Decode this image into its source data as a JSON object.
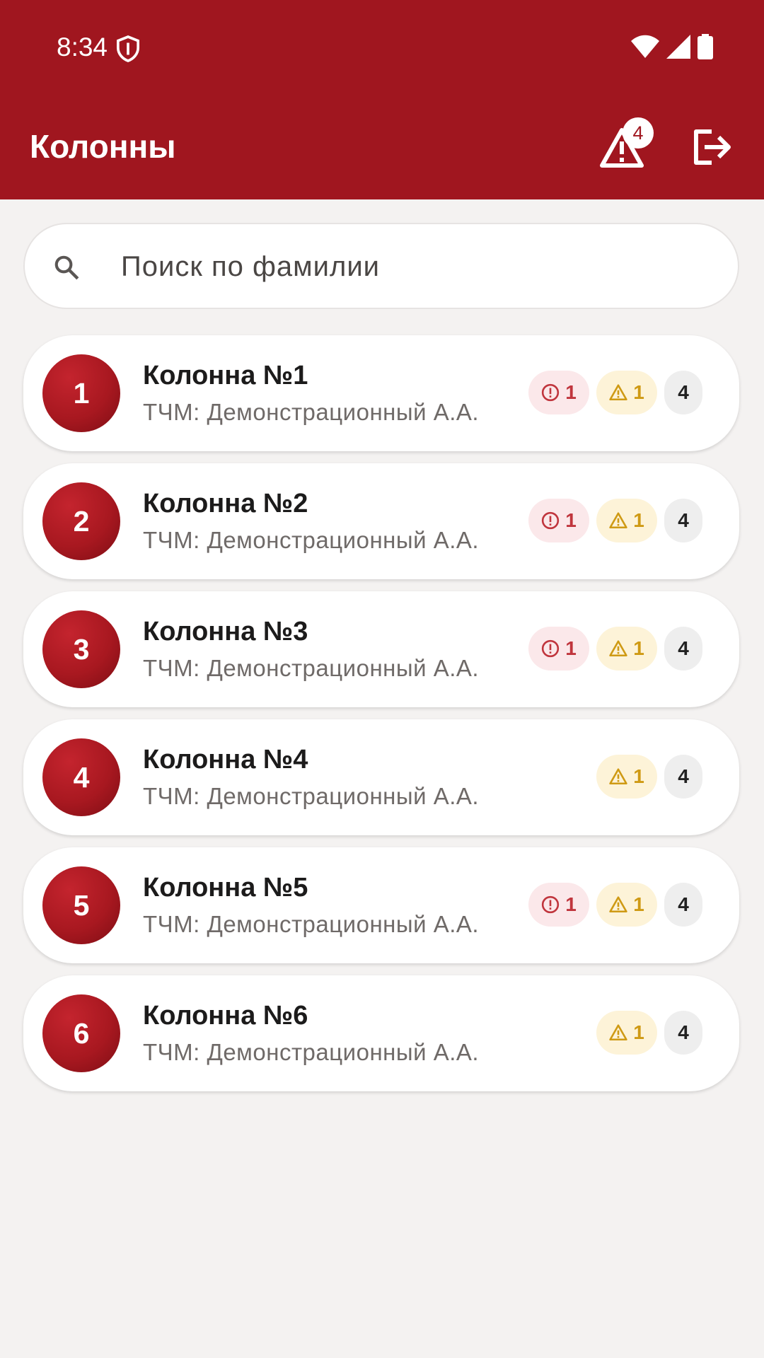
{
  "status_bar": {
    "time": "8:34"
  },
  "app_bar": {
    "title": "Колонны",
    "alerts_count": "4"
  },
  "search": {
    "placeholder": "Поиск по фамилии",
    "value": ""
  },
  "colors": {
    "brand": "#a0161f",
    "error": "#c0353d",
    "warning": "#cf9a14"
  },
  "columns": [
    {
      "number": "1",
      "name": "Колонна №1",
      "tcm": "ТЧМ: Демонстрационный А.А.",
      "errors": "1",
      "warnings": "1",
      "total": "4"
    },
    {
      "number": "2",
      "name": "Колонна №2",
      "tcm": "ТЧМ: Демонстрационный А.А.",
      "errors": "1",
      "warnings": "1",
      "total": "4"
    },
    {
      "number": "3",
      "name": "Колонна №3",
      "tcm": "ТЧМ: Демонстрационный А.А.",
      "errors": "1",
      "warnings": "1",
      "total": "4"
    },
    {
      "number": "4",
      "name": "Колонна №4",
      "tcm": "ТЧМ: Демонстрационный А.А.",
      "errors": null,
      "warnings": "1",
      "total": "4"
    },
    {
      "number": "5",
      "name": "Колонна №5",
      "tcm": "ТЧМ: Демонстрационный А.А.",
      "errors": "1",
      "warnings": "1",
      "total": "4"
    },
    {
      "number": "6",
      "name": "Колонна №6",
      "tcm": "ТЧМ: Демонстрационный А.А.",
      "errors": null,
      "warnings": "1",
      "total": "4"
    }
  ]
}
